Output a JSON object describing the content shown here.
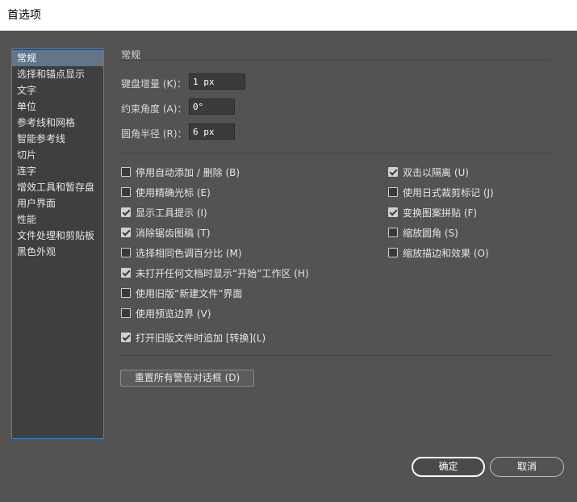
{
  "window": {
    "title": "首选项"
  },
  "sidebar": {
    "items": [
      {
        "label": "常规",
        "selected": true
      },
      {
        "label": "选择和锚点显示"
      },
      {
        "label": "文字"
      },
      {
        "label": "单位"
      },
      {
        "label": "参考线和网格"
      },
      {
        "label": "智能参考线"
      },
      {
        "label": "切片"
      },
      {
        "label": "连字"
      },
      {
        "label": "增效工具和暂存盘"
      },
      {
        "label": "用户界面"
      },
      {
        "label": "性能"
      },
      {
        "label": "文件处理和剪贴板"
      },
      {
        "label": "黑色外观"
      }
    ]
  },
  "main": {
    "section_title": "常规",
    "fields": {
      "keyboard_increment": {
        "label": "键盘增量 (K)：",
        "value": "1 px"
      },
      "constrain_angle": {
        "label": "约束角度 (A)：",
        "value": "0°"
      },
      "corner_radius": {
        "label": "圆角半径 (R)：",
        "value": "6 px"
      }
    },
    "checkboxes_left": [
      {
        "label": "停用自动添加 / 删除 (B)",
        "checked": false
      },
      {
        "label": "使用精确光标 (E)",
        "checked": false
      },
      {
        "label": "显示工具提示 (I)",
        "checked": true
      },
      {
        "label": "消除锯齿图稿 (T)",
        "checked": true
      },
      {
        "label": "选择相同色调百分比 (M)",
        "checked": false
      },
      {
        "label": "未打开任何文档时显示“开始”工作区 (H)",
        "checked": true
      },
      {
        "label": "使用旧版“新建文件”界面",
        "checked": false
      },
      {
        "label": "使用预览边界 (V)",
        "checked": false
      }
    ],
    "checkboxes_right": [
      {
        "label": "双击以隔离 (U)",
        "checked": true
      },
      {
        "label": "使用日式裁剪标记 (J)",
        "checked": false
      },
      {
        "label": "变换图案拼贴 (F)",
        "checked": true
      },
      {
        "label": "缩放圆角 (S)",
        "checked": false
      },
      {
        "label": "缩放描边和效果 (O)",
        "checked": false
      }
    ],
    "legacy_append": {
      "label": "打开旧版文件时追加 [转换](L)",
      "checked": true
    },
    "reset_button": "重置所有警告对话框 (D)"
  },
  "footer": {
    "ok_label": "确定",
    "cancel_label": "取消"
  }
}
